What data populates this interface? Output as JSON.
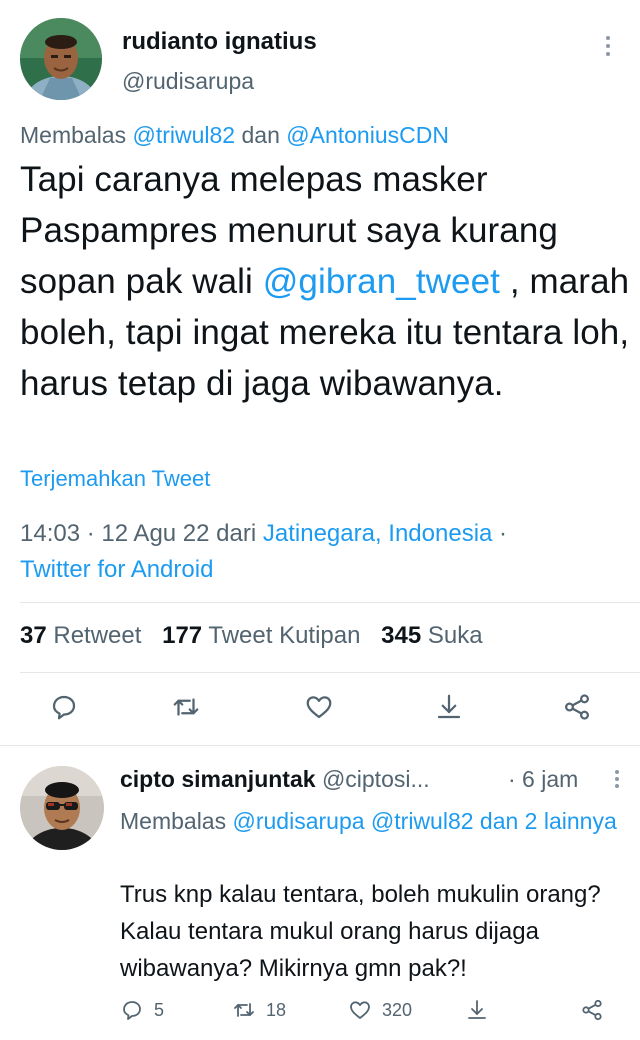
{
  "main_tweet": {
    "author_name": "rudianto ignatius",
    "author_handle": "@rudisarupa",
    "reply_prefix": "Membalas",
    "reply_user1": "@triwul82",
    "reply_conj": "dan",
    "reply_user2": "@AntoniusCDN",
    "text_part1": "Tapi caranya melepas masker Paspampres menurut saya kurang sopan pak wali ",
    "text_mention": "@gibran_tweet",
    "text_part2": " , marah boleh, tapi  ingat mereka itu tentara loh, harus tetap di jaga wibawanya.",
    "translate_label": "Terjemahkan Tweet",
    "time": "14:03",
    "date": "12 Agu 22",
    "from_label": "dari",
    "location": "Jatinegara, Indonesia",
    "client": "Twitter for Android",
    "retweets_count": "37",
    "retweets_label": "Retweet",
    "quotes_count": "177",
    "quotes_label": "Tweet Kutipan",
    "likes_count": "345",
    "likes_label": "Suka"
  },
  "reply_tweet": {
    "author_name": "cipto simanjuntak",
    "author_handle": "@ciptosi...",
    "time": "· 6 jam",
    "reply_prefix": "Membalas",
    "reply_user1": "@rudisarupa",
    "reply_user2": "@triwul82",
    "reply_rest": "dan 2 lainnya",
    "text": "Trus knp kalau tentara, boleh mukulin orang? Kalau tentara mukul orang harus dijaga wibawanya? Mikirnya gmn pak?!",
    "reply_count": "5",
    "retweet_count": "18",
    "like_count": "320"
  },
  "icons": {
    "reply": "comment-icon",
    "retweet": "retweet-icon",
    "like": "heart-icon",
    "bookmark": "download-icon",
    "share": "share-icon",
    "more": "more-vertical-icon"
  },
  "colors": {
    "link": "#1d9bf0",
    "secondary_text": "#536471",
    "primary_text": "#0f1419",
    "divider": "#e4e8eb"
  }
}
